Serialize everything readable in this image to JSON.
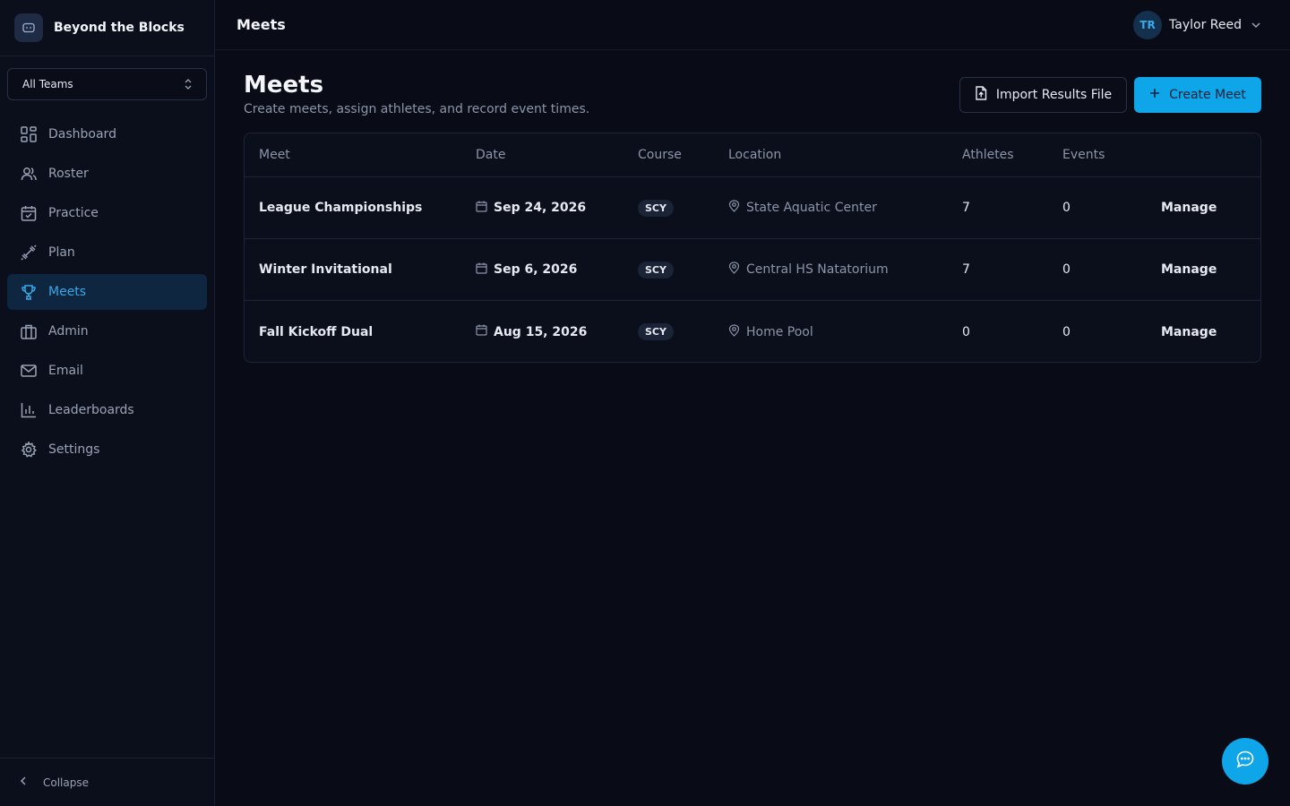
{
  "brand": {
    "name": "Beyond the Blocks",
    "icon": "swim-logo-icon"
  },
  "team_selector": {
    "value": "All Teams"
  },
  "nav": {
    "items": [
      {
        "label": "Dashboard",
        "icon": "grid-icon",
        "active": false
      },
      {
        "label": "Roster",
        "icon": "users-icon",
        "active": false
      },
      {
        "label": "Practice",
        "icon": "calendar-check-icon",
        "active": false
      },
      {
        "label": "Plan",
        "icon": "dumbbell-icon",
        "active": false
      },
      {
        "label": "Meets",
        "icon": "trophy-icon",
        "active": true
      },
      {
        "label": "Admin",
        "icon": "briefcase-icon",
        "active": false
      },
      {
        "label": "Email",
        "icon": "mail-icon",
        "active": false
      },
      {
        "label": "Leaderboards",
        "icon": "bar-chart-icon",
        "active": false
      },
      {
        "label": "Settings",
        "icon": "gear-icon",
        "active": false
      }
    ],
    "collapse_label": "Collapse"
  },
  "topbar": {
    "title": "Meets"
  },
  "user": {
    "initials": "TR",
    "name": "Taylor Reed"
  },
  "page": {
    "title": "Meets",
    "subtitle": "Create meets, assign athletes, and record event times.",
    "import_label": "Import Results File",
    "create_label": "Create Meet"
  },
  "table": {
    "headers": {
      "meet": "Meet",
      "date": "Date",
      "course": "Course",
      "location": "Location",
      "athletes": "Athletes",
      "events": "Events"
    },
    "rows": [
      {
        "meet": "League Championships",
        "date": "Sep 24, 2026",
        "course": "SCY",
        "location": "State Aquatic Center",
        "athletes": "7",
        "events": "0",
        "action": "Manage"
      },
      {
        "meet": "Winter Invitational",
        "date": "Sep 6, 2026",
        "course": "SCY",
        "location": "Central HS Natatorium",
        "athletes": "7",
        "events": "0",
        "action": "Manage"
      },
      {
        "meet": "Fall Kickoff Dual",
        "date": "Aug 15, 2026",
        "course": "SCY",
        "location": "Home Pool",
        "athletes": "0",
        "events": "0",
        "action": "Manage"
      }
    ]
  },
  "colors": {
    "accent": "#0ea5e9",
    "active_nav_bg": "#0f2640",
    "background": "#090c16"
  }
}
